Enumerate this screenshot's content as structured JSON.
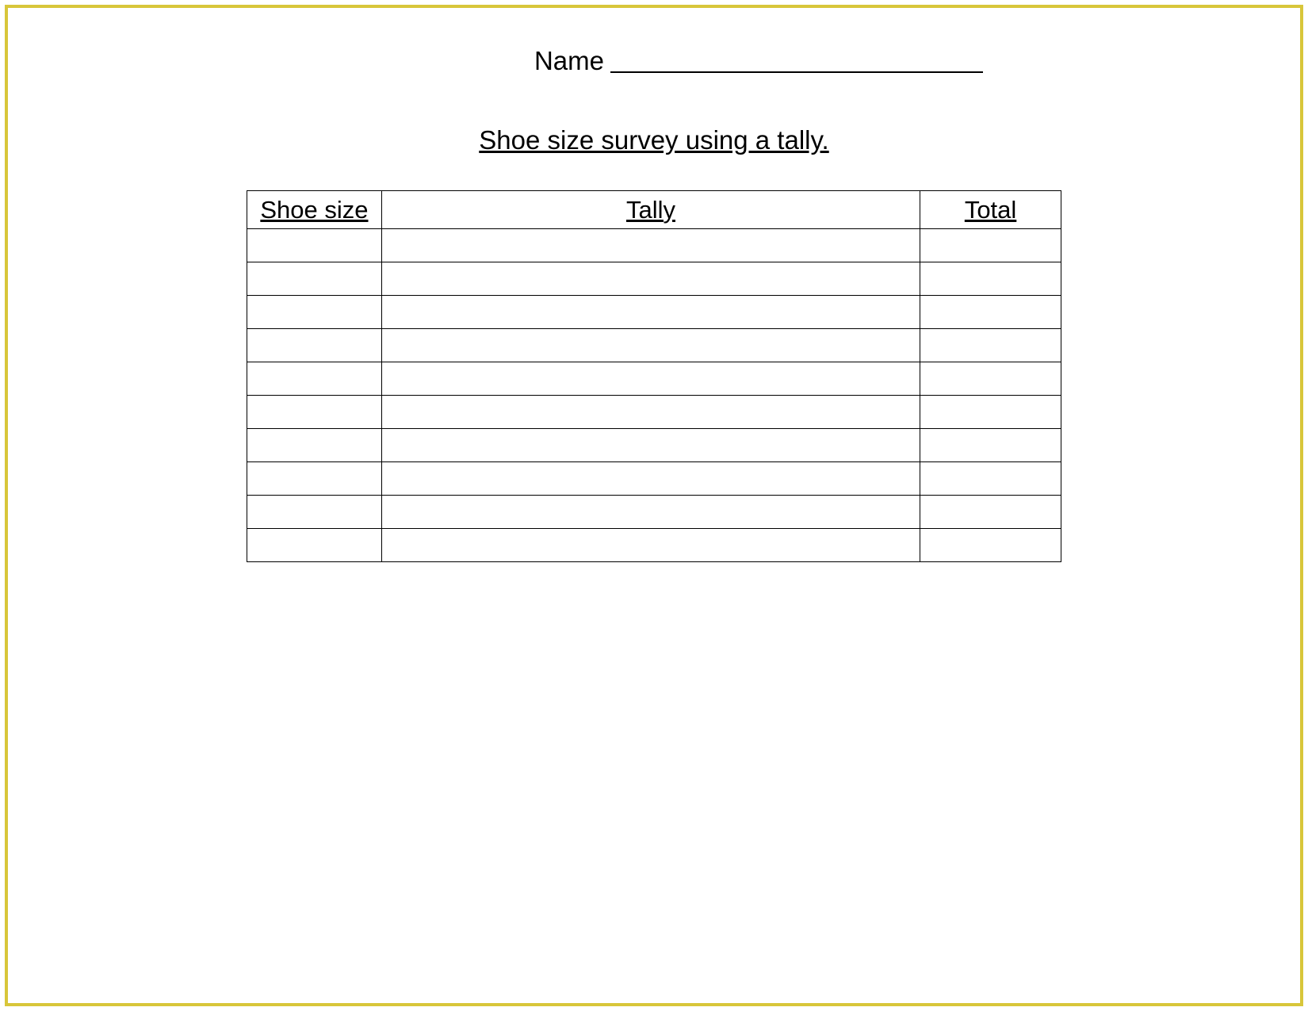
{
  "name_label": "Name",
  "title": "Shoe size survey using a tally.",
  "table": {
    "headers": {
      "shoe_size": "Shoe size",
      "tally": "Tally",
      "total": "Total"
    },
    "rows": [
      {
        "shoe_size": "",
        "tally": "",
        "total": ""
      },
      {
        "shoe_size": "",
        "tally": "",
        "total": ""
      },
      {
        "shoe_size": "",
        "tally": "",
        "total": ""
      },
      {
        "shoe_size": "",
        "tally": "",
        "total": ""
      },
      {
        "shoe_size": "",
        "tally": "",
        "total": ""
      },
      {
        "shoe_size": "",
        "tally": "",
        "total": ""
      },
      {
        "shoe_size": "",
        "tally": "",
        "total": ""
      },
      {
        "shoe_size": "",
        "tally": "",
        "total": ""
      },
      {
        "shoe_size": "",
        "tally": "",
        "total": ""
      },
      {
        "shoe_size": "",
        "tally": "",
        "total": ""
      }
    ]
  }
}
